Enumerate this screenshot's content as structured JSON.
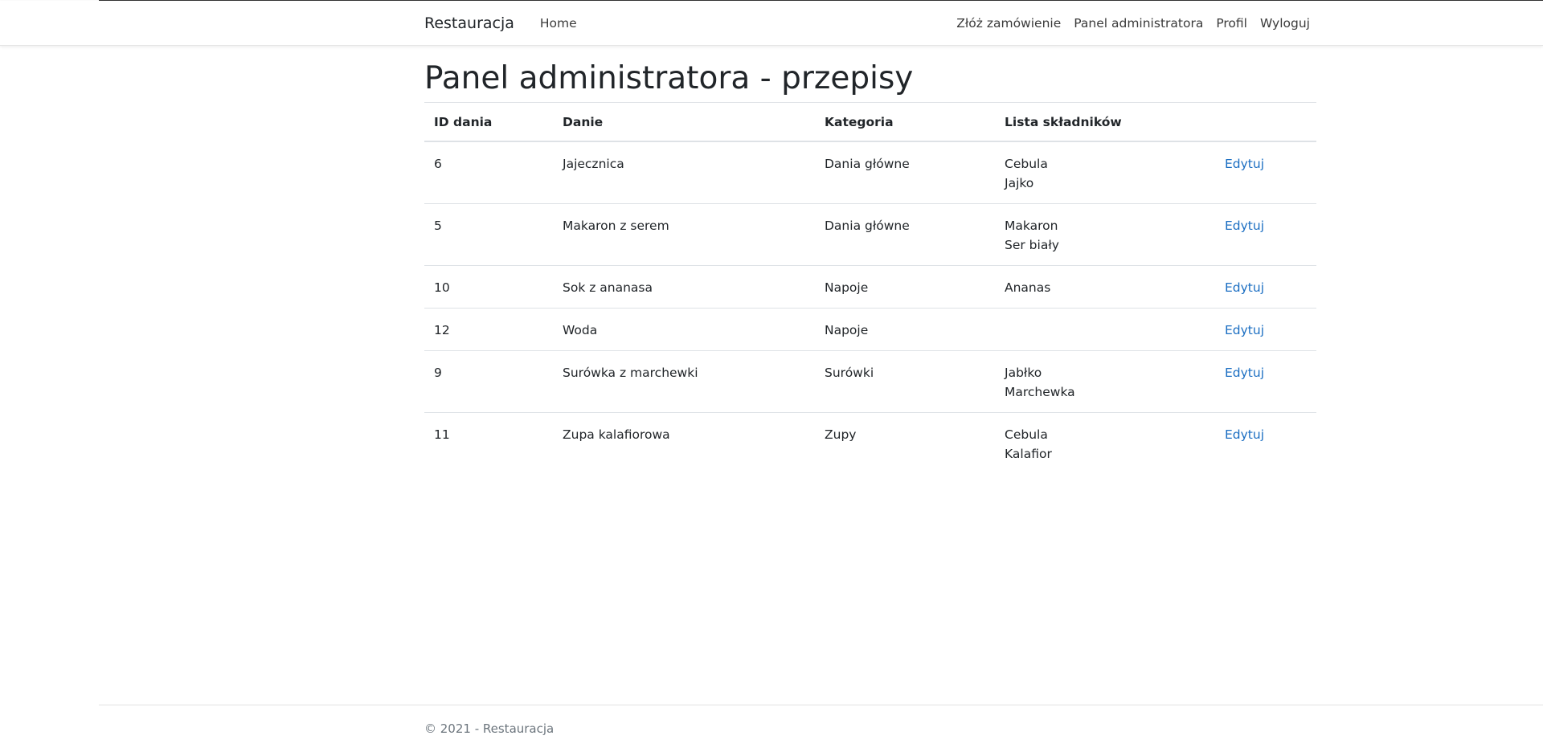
{
  "navbar": {
    "brand": "Restauracja",
    "left_links": [
      "Home"
    ],
    "right_links": [
      "Złóż zamówienie",
      "Panel administratora",
      "Profil",
      "Wyloguj"
    ]
  },
  "page": {
    "title": "Panel administratora - przepisy"
  },
  "table": {
    "headers": [
      "ID dania",
      "Danie",
      "Kategoria",
      "Lista składników",
      ""
    ],
    "rows": [
      {
        "id": "6",
        "dish": "Jajecznica",
        "category": "Dania główne",
        "ingredients": [
          "Cebula",
          "Jajko"
        ],
        "action": "Edytuj"
      },
      {
        "id": "5",
        "dish": "Makaron z serem",
        "category": "Dania główne",
        "ingredients": [
          "Makaron",
          "Ser biały"
        ],
        "action": "Edytuj"
      },
      {
        "id": "10",
        "dish": "Sok z ananasa",
        "category": "Napoje",
        "ingredients": [
          "Ananas"
        ],
        "action": "Edytuj"
      },
      {
        "id": "12",
        "dish": "Woda",
        "category": "Napoje",
        "ingredients": [],
        "action": "Edytuj"
      },
      {
        "id": "9",
        "dish": "Surówka z marchewki",
        "category": "Surówki",
        "ingredients": [
          "Jabłko",
          "Marchewka"
        ],
        "action": "Edytuj"
      },
      {
        "id": "11",
        "dish": "Zupa kalafiorowa",
        "category": "Zupy",
        "ingredients": [
          "Cebula",
          "Kalafior"
        ],
        "action": "Edytuj"
      }
    ]
  },
  "footer": {
    "text": "© 2021 - Restauracja"
  },
  "colors": {
    "link": "#1b6ec2",
    "text": "#212529",
    "muted": "#6c757d",
    "border": "#dee2e6"
  }
}
